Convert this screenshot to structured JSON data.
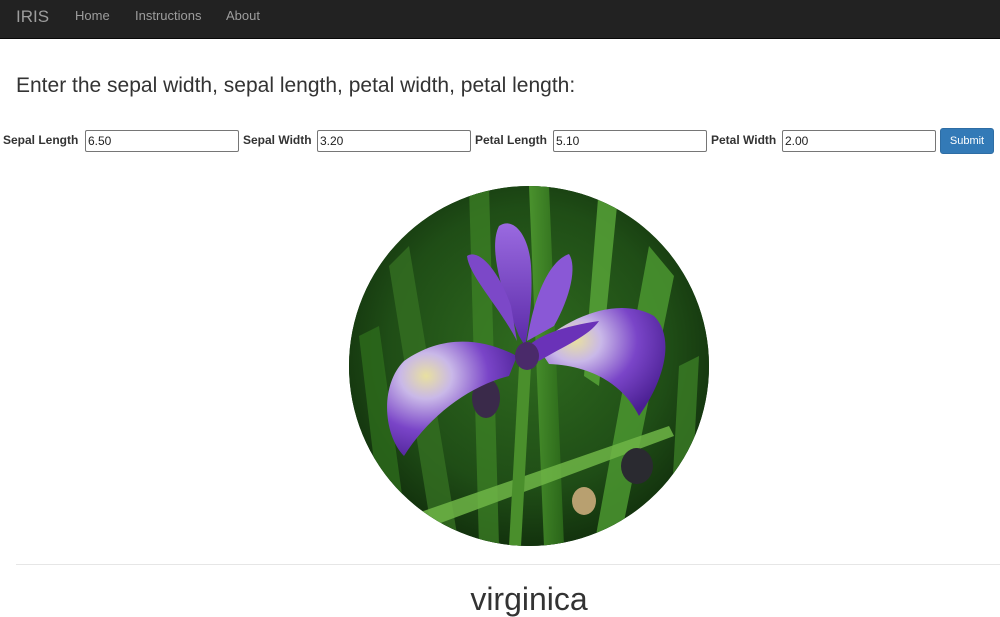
{
  "navbar": {
    "brand": "IRIS",
    "links": [
      "Home",
      "Instructions",
      "About"
    ]
  },
  "heading": "Enter the sepal width, sepal length, petal width, petal length:",
  "form": {
    "fields": [
      {
        "label": "Sepal Length",
        "value": "6.50"
      },
      {
        "label": "Sepal Width",
        "value": "3.20"
      },
      {
        "label": "Petal Length",
        "value": "5.10"
      },
      {
        "label": "Petal Width",
        "value": "2.00"
      }
    ],
    "submit_label": "Submit"
  },
  "image": {
    "subject": "iris-flower-photo"
  },
  "result": "virginica",
  "colors": {
    "navbar_bg": "#222222",
    "nav_text": "#9d9d9d",
    "button": "#337ab7",
    "petal": "#7a3fc4",
    "foliage": "#3c8a2a"
  }
}
